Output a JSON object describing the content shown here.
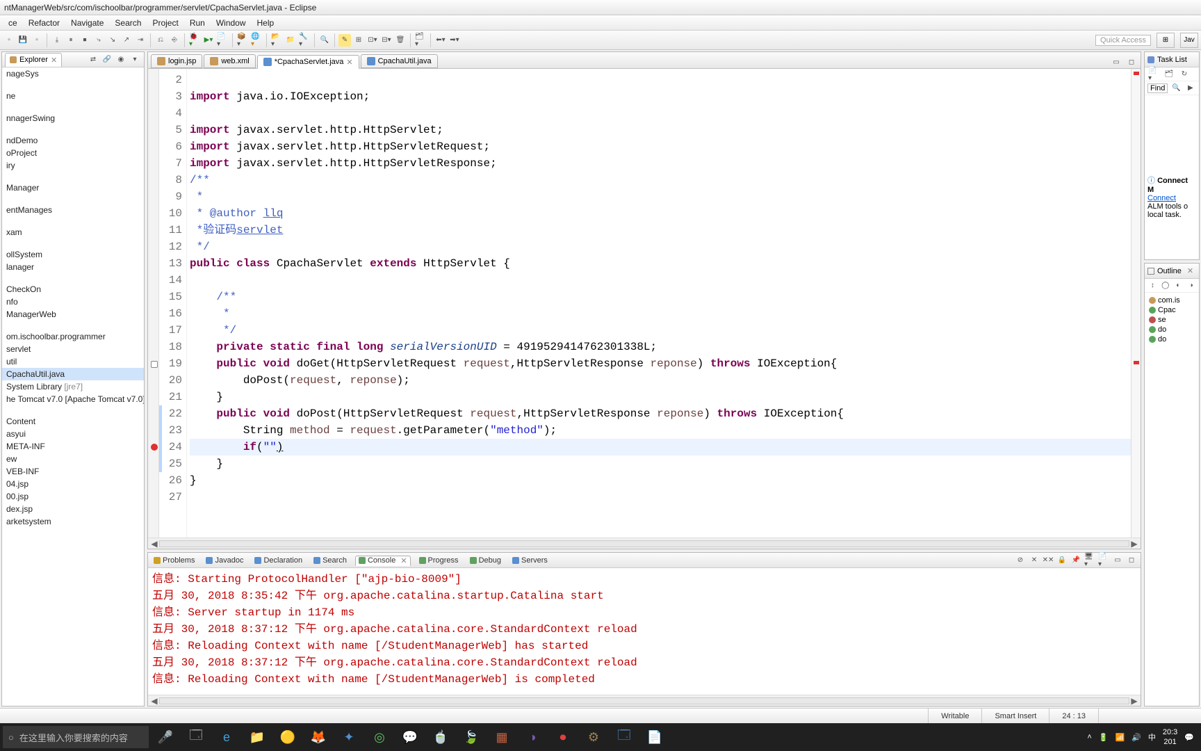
{
  "title_bar": "ntManagerWeb/src/com/ischoolbar/programmer/servlet/CpachaServlet.java - Eclipse",
  "menu": [
    "ce",
    "Refactor",
    "Navigate",
    "Search",
    "Project",
    "Run",
    "Window",
    "Help"
  ],
  "quick_access": "Quick Access",
  "perspective_label": "Jav",
  "explorer": {
    "tab": "Explorer",
    "items": [
      {
        "label": "nageSys",
        "spaced": false
      },
      {
        "label": "ne",
        "spaced": true
      },
      {
        "label": "nnagerSwing",
        "spaced": true
      },
      {
        "label": "ndDemo",
        "spaced": true
      },
      {
        "label": "oProject",
        "spaced": false
      },
      {
        "label": "iry",
        "spaced": false
      },
      {
        "label": "Manager",
        "spaced": true
      },
      {
        "label": "entManages",
        "spaced": true
      },
      {
        "label": "xam",
        "spaced": true
      },
      {
        "label": "ollSystem",
        "spaced": true
      },
      {
        "label": "lanager",
        "spaced": false
      },
      {
        "label": "CheckOn",
        "spaced": true
      },
      {
        "label": "nfo",
        "spaced": false
      },
      {
        "label": "ManagerWeb",
        "spaced": false
      },
      {
        "label": "om.ischoolbar.programmer",
        "spaced": true
      },
      {
        "label": "servlet",
        "spaced": false
      },
      {
        "label": "util",
        "spaced": false
      },
      {
        "label": "CpachaUtil.java",
        "spaced": false,
        "selected": true
      },
      {
        "label": "System Library ",
        "spaced": false,
        "gray": "[jre7]"
      },
      {
        "label": "he Tomcat v7.0 [Apache Tomcat v7.0]",
        "spaced": false
      },
      {
        "label": "Content",
        "spaced": true
      },
      {
        "label": "asyui",
        "spaced": false
      },
      {
        "label": "META-INF",
        "spaced": false
      },
      {
        "label": "ew",
        "spaced": false
      },
      {
        "label": "VEB-INF",
        "spaced": false
      },
      {
        "label": "04.jsp",
        "spaced": false
      },
      {
        "label": "00.jsp",
        "spaced": false
      },
      {
        "label": "dex.jsp",
        "spaced": false
      },
      {
        "label": "arketsystem",
        "spaced": false
      }
    ]
  },
  "editor": {
    "tabs": [
      {
        "label": "login.jsp",
        "active": false
      },
      {
        "label": "web.xml",
        "active": false
      },
      {
        "label": "*CpachaServlet.java",
        "active": true
      },
      {
        "label": "CpachaUtil.java",
        "active": false
      }
    ],
    "lines": [
      {
        "n": 2,
        "html": "",
        "cls": ""
      },
      {
        "n": 3,
        "html": "<span class=\"kw\">import</span> java.io.IOException;",
        "cls": ""
      },
      {
        "n": 4,
        "html": "",
        "cls": ""
      },
      {
        "n": 5,
        "html": "<span class=\"kw\">import</span> javax.servlet.http.HttpServlet;",
        "cls": ""
      },
      {
        "n": 6,
        "html": "<span class=\"kw\">import</span> javax.servlet.http.HttpServletRequest;",
        "cls": ""
      },
      {
        "n": 7,
        "html": "<span class=\"kw\">import</span> javax.servlet.http.HttpServletResponse;",
        "cls": ""
      },
      {
        "n": 8,
        "html": "<span class=\"doc\">/**</span>",
        "cls": ""
      },
      {
        "n": 9,
        "html": "<span class=\"doc\"> *</span>",
        "cls": ""
      },
      {
        "n": 10,
        "html": "<span class=\"doc\"> * @author <u>llq</u></span>",
        "cls": ""
      },
      {
        "n": 11,
        "html": "<span class=\"doc\"> *验证码<u>servlet</u></span>",
        "cls": ""
      },
      {
        "n": 12,
        "html": "<span class=\"doc\"> */</span>",
        "cls": ""
      },
      {
        "n": 13,
        "html": "<span class=\"kw\">public</span> <span class=\"kw\">class</span> CpachaServlet <span class=\"kw\">extends</span> HttpServlet {",
        "cls": ""
      },
      {
        "n": 14,
        "html": "",
        "cls": ""
      },
      {
        "n": 15,
        "html": "    <span class=\"doc\">/**</span>",
        "cls": ""
      },
      {
        "n": 16,
        "html": "    <span class=\"doc\"> *</span>",
        "cls": ""
      },
      {
        "n": 17,
        "html": "    <span class=\"doc\"> */</span>",
        "cls": ""
      },
      {
        "n": 18,
        "html": "    <span class=\"kw\">private static final long</span> <span class=\"ital\" style=\"color:#1a3f8b;\">serialVersionUID</span> = 4919529414762301338L;",
        "cls": ""
      },
      {
        "n": 19,
        "html": "    <span class=\"kw\">public void</span> doGet(HttpServletRequest <span style=\"color:#6a3e3e;\">request</span>,HttpServletResponse <span style=\"color:#6a3e3e;\">reponse</span>) <span class=\"kw\">throws</span> IOException{",
        "cls": ""
      },
      {
        "n": 20,
        "html": "        doPost(<span style=\"color:#6a3e3e;\">request</span>, <span style=\"color:#6a3e3e;\">reponse</span>);",
        "cls": ""
      },
      {
        "n": 21,
        "html": "    }",
        "cls": ""
      },
      {
        "n": 22,
        "html": "    <span class=\"kw\">public void</span> doPost(HttpServletRequest <span style=\"color:#6a3e3e;\">request</span>,HttpServletResponse <span style=\"color:#6a3e3e;\">reponse</span>) <span class=\"kw\">throws</span> IOException{",
        "cls": ""
      },
      {
        "n": 23,
        "html": "        String <span style=\"color:#6a3e3e;\">method</span> = <span style=\"color:#6a3e3e;\">request</span>.getParameter(<span class=\"str\">\"method\"</span>);",
        "cls": ""
      },
      {
        "n": 24,
        "html": "        <span class=\"kw\">if</span>(<span class=\"str\">\"\"</span><u>)</u>",
        "cls": "cur-line"
      },
      {
        "n": 25,
        "html": "    }",
        "cls": ""
      },
      {
        "n": 26,
        "html": "}",
        "cls": ""
      },
      {
        "n": 27,
        "html": "",
        "cls": ""
      }
    ],
    "gutter_markers": {
      "19": "fold",
      "22": "bar",
      "23": "bar",
      "24": "err-dot bar",
      "25": "bar"
    }
  },
  "console": {
    "tabs": [
      "Problems",
      "Javadoc",
      "Declaration",
      "Search",
      "Console",
      "Progress",
      "Debug",
      "Servers"
    ],
    "active": "Console",
    "lines": [
      "信息: Starting ProtocolHandler [\"ajp-bio-8009\"]",
      "五月 30, 2018 8:35:42 下午 org.apache.catalina.startup.Catalina start",
      "信息: Server startup in 1174 ms",
      "五月 30, 2018 8:37:12 下午 org.apache.catalina.core.StandardContext reload",
      "信息: Reloading Context with name [/StudentManagerWeb] has started",
      "五月 30, 2018 8:37:12 下午 org.apache.catalina.core.StandardContext reload",
      "信息: Reloading Context with name [/StudentManagerWeb] is completed"
    ]
  },
  "task_list": {
    "title": "Task List",
    "find": "Find",
    "connect_title": "Connect M",
    "connect_link": "Connect",
    "connect_text1": "ALM tools o",
    "connect_text2": "local task."
  },
  "outline": {
    "title": "Outline",
    "items": [
      {
        "ico": "o-pkg",
        "label": "com.is"
      },
      {
        "ico": "o-cls",
        "label": "Cpac"
      },
      {
        "ico": "o-fld",
        "label": "se"
      },
      {
        "ico": "o-mth",
        "label": "do"
      },
      {
        "ico": "o-mth",
        "label": "do"
      }
    ]
  },
  "status": {
    "writable": "Writable",
    "insert": "Smart Insert",
    "pos": "24 : 13"
  },
  "taskbar": {
    "search_placeholder": "在这里输入你要搜索的内容",
    "clock_time": "20:3",
    "clock_date": "201",
    "ime": "中"
  }
}
